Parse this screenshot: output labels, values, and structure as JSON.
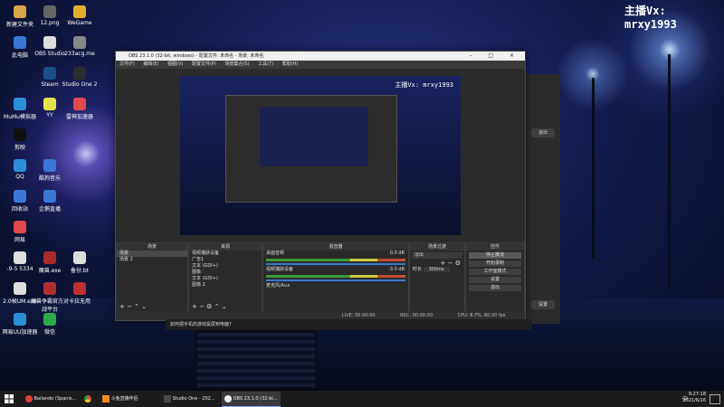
{
  "desktop": {
    "streamer_label": "主播Vx: mrxy1993",
    "icons": [
      {
        "label": "新建文件夹",
        "icon": "folder-icon"
      },
      {
        "label": "12.png",
        "icon": "image-icon"
      },
      {
        "label": "WeGame",
        "icon": "wegame-icon"
      },
      {
        "label": "此电脑",
        "icon": "computer-icon"
      },
      {
        "label": "OBS Studio",
        "icon": "obs-icon"
      },
      {
        "label": "233acg.me",
        "icon": "web-icon"
      },
      {
        "label": "Steam",
        "icon": "steam-icon"
      },
      {
        "label": "Studio One 2",
        "icon": "studio-one-icon"
      },
      {
        "label": "MuMu模拟器",
        "icon": "mumu-icon"
      },
      {
        "label": "YY",
        "icon": "yy-icon"
      },
      {
        "label": "雷神加速器",
        "icon": "leishen-icon"
      },
      {
        "label": "剪映",
        "icon": "capcut-icon"
      },
      {
        "label": "回收站",
        "icon": "recycle-bin-icon"
      },
      {
        "label": "QQ",
        "icon": "qq-icon"
      },
      {
        "label": "酷狗音乐",
        "icon": "kugou-icon"
      },
      {
        "label": "网易",
        "icon": "netease-icon"
      },
      {
        "label": "企鹅直播",
        "icon": "penguin-icon"
      },
      {
        "label": "-9-5 5334",
        "icon": "file-icon"
      },
      {
        "label": "魔兽.exe",
        "icon": "exe-icon"
      },
      {
        "label": "备份.bt",
        "icon": "file-icon"
      },
      {
        "label": "2.0帧UM.exe",
        "icon": "exe-icon"
      },
      {
        "label": "魔兽争霸官方对战平台",
        "icon": "war3-icon"
      },
      {
        "label": "卡拉无用",
        "icon": "app-icon"
      },
      {
        "label": "网易UU加速器",
        "icon": "uu-icon"
      },
      {
        "label": "微信",
        "icon": "wechat-icon"
      }
    ]
  },
  "obs": {
    "title": "OBS 23.1.0 (32-bit, windows) - 配置文件: 未命名 - 场景: 未命名",
    "menu": [
      "文件(F)",
      "编辑(E)",
      "视图(V)",
      "配置文件(P)",
      "场景集合(S)",
      "工具(T)",
      "帮助(H)"
    ],
    "preview_streamer": "主播Vx: mrxy1993",
    "docks": {
      "scenes": {
        "title": "场景",
        "items": [
          "场景",
          "场景 2"
        ]
      },
      "sources": {
        "title": "来源",
        "items": [
          "视频捕获设备",
          "广告1",
          "文本 (GDI+)",
          "图像",
          "文本 (GDI+)",
          "图像 2"
        ]
      },
      "mixer": {
        "title": "混音器",
        "channels": [
          {
            "name": "桌面音频",
            "db": "0.0 dB"
          },
          {
            "name": "视频捕获设备",
            "db": "-3.0 dB"
          },
          {
            "name": "麦克风/Aux",
            "db": "0.0 dB"
          }
        ]
      },
      "transitions": {
        "title": "场景过渡",
        "type": "淡出",
        "duration_label": "时长",
        "duration": "300ms"
      },
      "controls": {
        "title": "控件",
        "buttons": [
          "停止推流",
          "开始录制",
          "工作室模式",
          "设置",
          "退出"
        ]
      }
    },
    "status": {
      "live": "LIVE: 00:00:00",
      "rec": "REC: 00:00:00",
      "cpu": "CPU: 8.7%, 60.00 fps"
    }
  },
  "side_panel": {
    "button_label": "退出",
    "bottom_label": "设置"
  },
  "below_obs_text": "如何把手机的游戏投屏到电脑?",
  "taskbar": {
    "tasks": [
      {
        "label": "Bailando (Spanis...",
        "icon": "music-icon",
        "active": false
      },
      {
        "label": "",
        "icon": "chrome-icon",
        "active": false
      },
      {
        "label": "斗鱼直播伴侣",
        "icon": "douyu-icon",
        "active": false
      },
      {
        "label": "Studio One - 202...",
        "icon": "studio-one-icon",
        "active": false
      },
      {
        "label": "OBS 23.1.0 (32-bi...",
        "icon": "obs-icon",
        "active": true
      }
    ],
    "tray_lang": "中",
    "clock_time": "9:27:18",
    "clock_date": "2021/6/16"
  }
}
